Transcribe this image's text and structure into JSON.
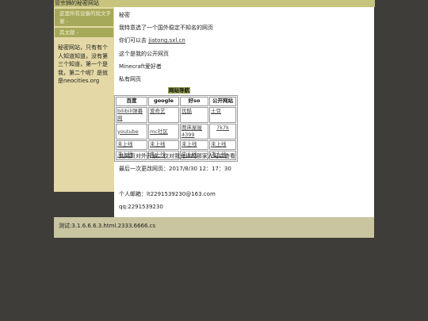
{
  "header": {
    "title": "管宗狮的秘密网站"
  },
  "sidebar": {
    "links": [
      "这里所有设备的就文字谢 -",
      "其文献 -"
    ],
    "note": "秘密网站，只有有个人知道知道，没有第三个知道，第一个是我，第二个呢？是就是neocities.org"
  },
  "main": {
    "title": "秘密",
    "intro": "我特意选了一个国外稳定不知名的网页",
    "also_prefix": "你们可以去",
    "also_link": "jiatong.sxl.cn",
    "public_site": "这个是我的公开网页",
    "minecraft": "Minecraft爱好者",
    "private_site": "私有网页",
    "nav_title": "网站导航",
    "nav_headers": [
      "百度",
      "google",
      "好so",
      "公开网站"
    ],
    "nav_rows": [
      [
        "bilibili弹幕网",
        "爱奇艺",
        "优酷",
        "土豆"
      ],
      [
        "youtube",
        "mc社区",
        "图床屋屋4399",
        "7k7k"
      ],
      [
        "未上线",
        "未上线",
        "未上线",
        "未上线"
      ],
      [
        "未上线",
        "未上线",
        "未上线",
        "未上线"
      ]
    ],
    "notice": "此网页对外开放：仅对我允许的那家人可以查看",
    "updated": "最后一次更改网页：2017/8/30 12：17：30",
    "email": "个人邮箱：lt2291539230@163.com",
    "qq": "qq:2291539230"
  },
  "footer": {
    "text": "测试:3.1.6.6.6.3.html.2333.6666.cs"
  }
}
